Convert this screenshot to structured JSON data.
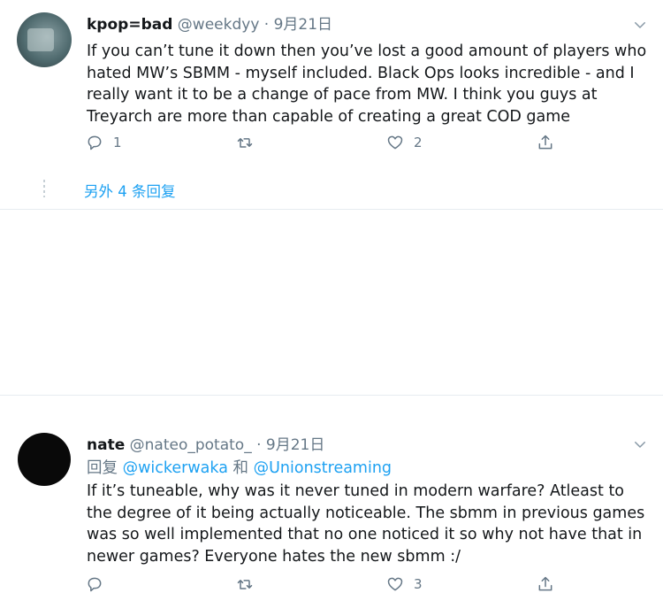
{
  "tweets": [
    {
      "display_name": "kpop=bad",
      "handle": "@weekdyy",
      "separator": "·",
      "date": "9月21日",
      "body": "If you can’t tune it down then you’ve lost a good amount of players who hated MW’s SBMM - myself included. Black Ops looks incredible - and I really want it to be a change of pace from MW. I think you guys at Treyarch are more than capable of creating a great COD game",
      "actions": {
        "reply_count": "1",
        "retweet_count": "",
        "like_count": "2"
      },
      "show_more": "另外 4 条回复"
    },
    {
      "display_name": "nate",
      "handle": "@nateo_potato_",
      "separator": "·",
      "date": "9月21日",
      "reply_prefix": "回复",
      "mention_1": "@wickerwaka",
      "conjunction": "和",
      "mention_2": "@Unionstreaming",
      "body": "If it’s tuneable, why was it never tuned in modern warfare? Atleast to the degree of it being actually noticeable. The sbmm in previous games was so well implemented that no one noticed it so why not have that in newer games? Everyone hates the new sbmm :/",
      "actions": {
        "reply_count": "",
        "retweet_count": "",
        "like_count": "3"
      }
    }
  ],
  "icons": [
    "reply-icon",
    "retweet-icon",
    "like-icon",
    "share-icon",
    "chevron-down-icon"
  ],
  "colors": {
    "link": "#1da1f2",
    "muted": "#657786",
    "text": "#14171a",
    "divider": "#e6ecf0"
  }
}
